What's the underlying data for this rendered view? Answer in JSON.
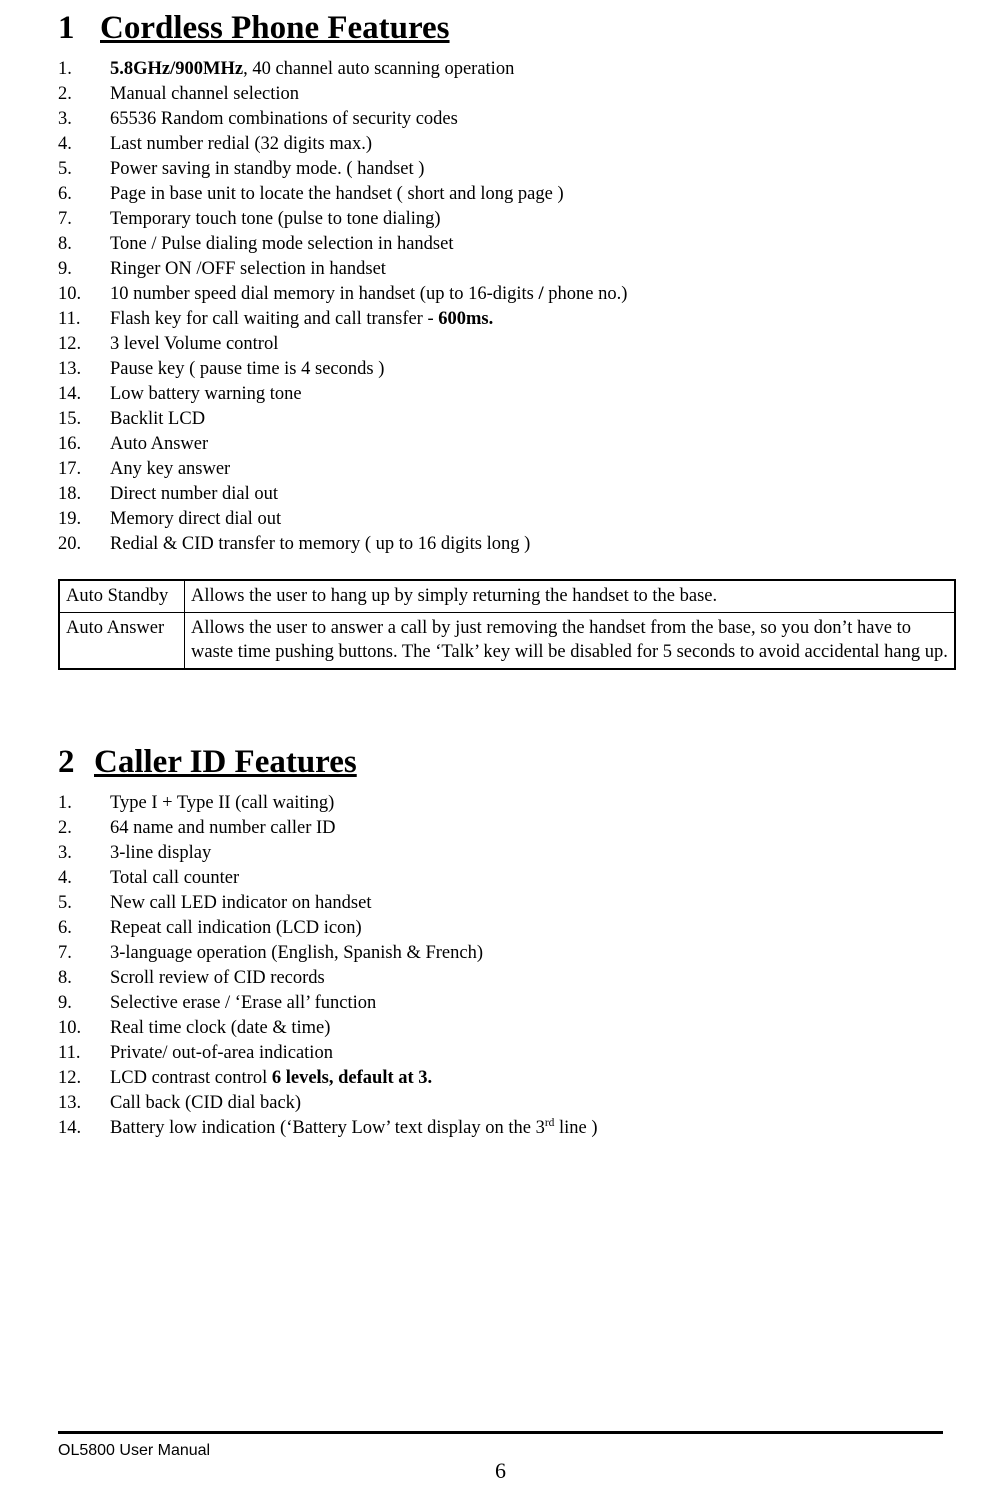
{
  "document": {
    "sections": [
      {
        "number": "1",
        "title": "Cordless Phone Features",
        "items": [
          {
            "n": "1.",
            "html": "<span class=\"b\">5.8GHz/900MHz</span>,  40 channel auto scanning operation"
          },
          {
            "n": "2.",
            "html": "Manual channel selection"
          },
          {
            "n": "3.",
            "html": "65536 Random combinations of security codes"
          },
          {
            "n": "4.",
            "html": "Last number redial (32 digits max.)"
          },
          {
            "n": "5.",
            "html": "Power saving in standby mode. ( handset )"
          },
          {
            "n": "6.",
            "html": "Page in base unit to locate the handset ( short and long page )"
          },
          {
            "n": "7.",
            "html": "Temporary touch tone (pulse to tone dialing)"
          },
          {
            "n": "8.",
            "html": "Tone / Pulse dialing mode selection in handset"
          },
          {
            "n": "9.",
            "html": "Ringer ON /OFF selection in handset"
          },
          {
            "n": "10.",
            "html": "10 number speed dial memory in handset (up to 16-digits <span class=\"b\">/</span> phone no.)"
          },
          {
            "n": "11.",
            "html": "Flash key for call waiting and call transfer - <span class=\"b\">600ms.</span>"
          },
          {
            "n": "12.",
            "html": "3 level Volume control"
          },
          {
            "n": "13.",
            "html": "Pause key ( pause time is 4 seconds )"
          },
          {
            "n": "14.",
            "html": "Low battery warning tone"
          },
          {
            "n": "15.",
            "html": "Backlit LCD"
          },
          {
            "n": "16.",
            "html": "Auto Answer"
          },
          {
            "n": "17.",
            "html": "Any key answer"
          },
          {
            "n": "18.",
            "html": "Direct number dial out"
          },
          {
            "n": "19.",
            "html": "Memory direct dial out"
          },
          {
            "n": "20.",
            "html": "Redial &amp; CID transfer to memory ( up to 16 digits long )"
          }
        ]
      },
      {
        "number": "2",
        "title": "Caller ID Features",
        "items": [
          {
            "n": "1.",
            "html": "Type I + Type II (call waiting)"
          },
          {
            "n": "2.",
            "html": "64 name and number caller ID"
          },
          {
            "n": "3.",
            "html": "3-line display"
          },
          {
            "n": "4.",
            "html": "Total call counter"
          },
          {
            "n": "5.",
            "html": "New call LED indicator on handset"
          },
          {
            "n": "6.",
            "html": "Repeat call indication (LCD icon)"
          },
          {
            "n": "7.",
            "html": "3-language operation (English, Spanish &amp; French)"
          },
          {
            "n": "8.",
            "html": "Scroll review of CID records"
          },
          {
            "n": "9.",
            "html": "Selective erase / &lsquo;Erase all&rsquo; function"
          },
          {
            "n": "10.",
            "html": "Real time clock (date &amp; time)"
          },
          {
            "n": "11.",
            "html": "Private/ out-of-area indication"
          },
          {
            "n": "12.",
            "html": "LCD contrast control <span class=\"b\">6 levels, default at 3.</span>"
          },
          {
            "n": "13.",
            "html": "Call back (CID dial back)"
          },
          {
            "n": "14.",
            "html": "Battery low indication (&lsquo;Battery Low&rsquo; text display on the 3<sup>rd</sup> line )"
          }
        ]
      }
    ],
    "table": {
      "rows": [
        {
          "label": "Auto Standby",
          "description": "Allows the user to hang up by simply returning the handset to the base."
        },
        {
          "label": "Auto Answer",
          "description": "Allows the user to answer a call by just removing the handset from the base, so you don’t have to waste time pushing buttons. The ‘Talk’ key will be disabled for 5 seconds to avoid accidental hang up."
        }
      ]
    },
    "footer": {
      "manual_label": "OL5800 User Manual",
      "page_number": "6"
    }
  }
}
